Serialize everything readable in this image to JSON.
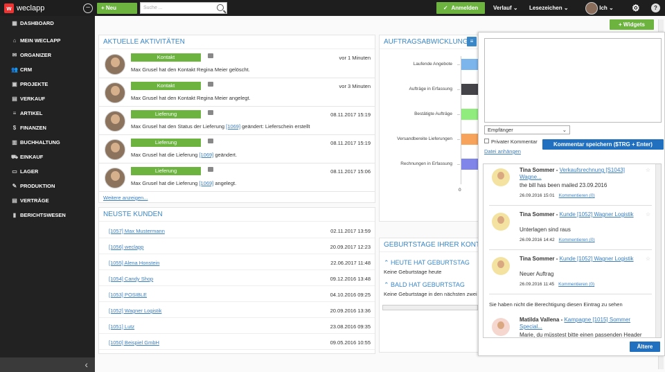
{
  "topbar": {
    "logo": "weclapp",
    "neu": "+ Neu",
    "search_placeholder": "Suche ...",
    "anmelden": "Anmelden",
    "verlauf": "Verlauf",
    "lesezeichen": "Lesezeichen",
    "ich": "Ich"
  },
  "sidebar": {
    "items": [
      "DASHBOARD",
      "MEIN WECLAPP",
      "ORGANIZER",
      "CRM",
      "PROJEKTE",
      "VERKAUF",
      "ARTIKEL",
      "FINANZEN",
      "BUCHHALTUNG",
      "EINKAUF",
      "LAGER",
      "PRODUKTION",
      "VERTRÄGE",
      "BERICHTSWESEN"
    ],
    "icons": [
      "dashboard-icon",
      "home-icon",
      "mail-icon",
      "people-icon",
      "briefcase-icon",
      "document-icon",
      "list-icon",
      "dollar-icon",
      "book-icon",
      "cart-icon",
      "warehouse-icon",
      "wrench-icon",
      "document-icon",
      "chart-icon"
    ]
  },
  "widgets_button": "+ Widgets",
  "activities": {
    "title": "AKTUELLE AKTIVITÄTEN",
    "items": [
      {
        "tag": "Kontakt",
        "time": "vor 1 Minuten",
        "pre": "Max Grusel hat den Kontakt Regina Meier gelöscht.",
        "link": "",
        "post": ""
      },
      {
        "tag": "Kontakt",
        "time": "vor 3 Minuten",
        "pre": "Max Grusel hat den Kontakt Regina Meier angelegt.",
        "link": "",
        "post": ""
      },
      {
        "tag": "Lieferung",
        "time": "08.11.2017 15:19",
        "pre": "Max Grusel hat den Status der Lieferung ",
        "link": "[1069]",
        "post": " geändert: Lieferschein erstellt"
      },
      {
        "tag": "Lieferung",
        "time": "08.11.2017 15:19",
        "pre": "Max Grusel hat die Lieferung ",
        "link": "[1069]",
        "post": " geändert."
      },
      {
        "tag": "Lieferung",
        "time": "08.11.2017 15:06",
        "pre": "Max Grusel hat die Lieferung ",
        "link": "[1069]",
        "post": " angelegt."
      }
    ],
    "more": "Weitere anzeigen..."
  },
  "customers": {
    "title": "NEUSTE KUNDEN",
    "rows": [
      {
        "name": "[1057] Max Mustermann",
        "date": "02.11.2017 13:59"
      },
      {
        "name": "[1056] weclapp",
        "date": "20.09.2017 12:23"
      },
      {
        "name": "[1055] Alena Honstein",
        "date": "22.06.2017 11:48"
      },
      {
        "name": "[1054] Candy Shop",
        "date": "09.12.2016 13:48"
      },
      {
        "name": "[1053] POSIBLE",
        "date": "04.10.2016 09:25"
      },
      {
        "name": "[1052] Wagner Logistik",
        "date": "20.09.2016 13:36"
      },
      {
        "name": "[1051] Lutz",
        "date": "23.08.2016 09:35"
      },
      {
        "name": "[1050] Beispiel GmbH",
        "date": "09.05.2016 10:55"
      }
    ]
  },
  "orders": {
    "title": "AUFTRAGSABWICKLUNG",
    "axis_zero": "0"
  },
  "chart_data": {
    "type": "bar",
    "categories": [
      "Laufende Angebote",
      "Aufträge in Erfassung",
      "Bestätigte Aufträge",
      "Versandbereite Lieferungen",
      "Rechnungen in Erfassung"
    ],
    "colors": [
      "#7cb5ec",
      "#434348",
      "#90ed7d",
      "#f7a35c",
      "#8085e9"
    ],
    "xtick": "0"
  },
  "birthdays": {
    "title": "GEBURTSTAGE IHRER KONTAKTE",
    "today_title": "HEUTE HAT GEBURTSTAG",
    "today_text": "Keine Geburtstage heute",
    "soon_title": "BALD HAT GEBURTSTAG",
    "soon_text": "Keine Geburtstage in den nächsten zwei Wochen"
  },
  "comment": {
    "recipient": "Empfänger",
    "private": "Privater Kommentar",
    "attach": "Datei anhängen",
    "save": "Kommentar speichern ($TRG + Enter)"
  },
  "feed": {
    "items": [
      {
        "name": "Tina Sommer",
        "sep": " - ",
        "link": "Verkaufsrechnung [S1043] Wagne...",
        "msg": "the bill has been mailed 23.09.2016",
        "date": "26.09.2016 15:01",
        "comment": "Kommentieren (0)"
      },
      {
        "name": "Tina Sommer",
        "sep": " - ",
        "link": "Kunde [1052] Wagner Logistik",
        "msg": "Unterlagen sind raus",
        "date": "26.09.2016 14:42",
        "comment": "Kommentieren (0)"
      },
      {
        "name": "Tina Sommer",
        "sep": " - ",
        "link": "Kunde [1052] Wagner Logistik",
        "msg": "Neuer Auftrag",
        "date": "26.09.2016 11:45",
        "comment": "Kommentieren (0)"
      }
    ],
    "no_permission": "Sie haben nicht die Berechtigung diesen Eintrag zu sehen",
    "last": {
      "name": "Matilda Vallena",
      "sep": " - ",
      "link": "Kampagne [1015] Sommer Special...",
      "msg": "Marie, du müsstest bitte einen passenden Header"
    },
    "more": "Ältere"
  }
}
